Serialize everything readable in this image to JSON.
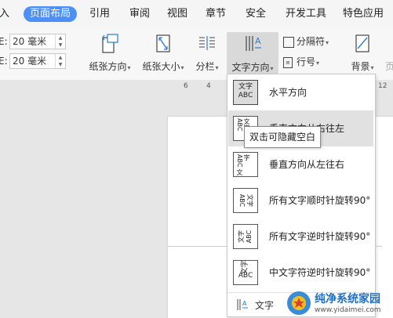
{
  "menu": {
    "items": [
      "入",
      "页面布局",
      "引用",
      "审阅",
      "视图",
      "章节",
      "安全",
      "开发工具",
      "特色应用"
    ],
    "active_index": 1
  },
  "ribbon": {
    "margins": [
      {
        "prefix": "E:",
        "value": "20 毫米"
      },
      {
        "prefix": "E:",
        "value": "20 毫米"
      }
    ],
    "tools": {
      "orientation": "纸张方向",
      "size": "纸张大小",
      "columns": "分栏",
      "text_direction": "文字方向",
      "separator": "分隔符",
      "line_numbers": "行号",
      "background": "背景",
      "page_border_partial": "页"
    }
  },
  "ruler": {
    "ticks": [
      "6",
      "4",
      "12"
    ]
  },
  "dropdown": {
    "items": [
      {
        "label": "水平方向",
        "icon": "horizontal-text-icon"
      },
      {
        "label": "垂直方向从右往左",
        "icon": "vertical-rtl-icon"
      },
      {
        "label": "垂直方向从左往右",
        "icon": "vertical-ltr-icon"
      },
      {
        "label": "所有文字顺时针旋转90°",
        "icon": "rotate-cw-icon"
      },
      {
        "label": "所有文字逆时针旋转90°",
        "icon": "rotate-ccw-icon"
      },
      {
        "label": "中文字符逆时针旋转90°",
        "icon": "chinese-rotate-icon"
      }
    ],
    "bottom_label": "文字",
    "hovered_index": 1
  },
  "tooltip": {
    "text": "双击可隐藏空白"
  },
  "watermark": {
    "title": "纯净系统家园",
    "url": "www.yidaimei.com"
  },
  "colors": {
    "accent": "#4d8ef7",
    "hover": "#e1e1e1",
    "icon_blue": "#2b7bd9"
  }
}
